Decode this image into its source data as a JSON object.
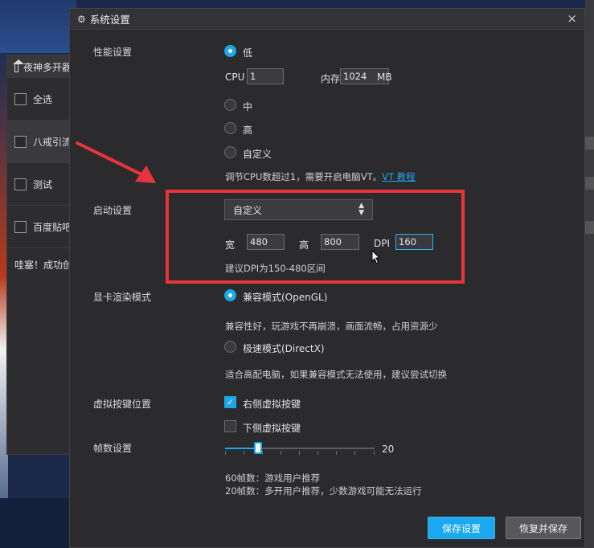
{
  "background_window": {
    "title": "夜神多开器",
    "select_all": "全选",
    "instances": [
      "八戒引流",
      "测试",
      "百度贴吧"
    ],
    "status_note": "哇塞！成功创"
  },
  "dialog": {
    "title": "系统设置",
    "performance": {
      "label": "性能设置",
      "options": [
        "低",
        "中",
        "高",
        "自定义"
      ],
      "selected": "低",
      "cpu_label": "CPU",
      "cpu_value": "1",
      "memory_label": "内存",
      "memory_value": "1024",
      "memory_unit": "MB",
      "hint_text": "调节CPU数超过1，需要开启电脑VT。",
      "hint_link": "VT 教程"
    },
    "startup": {
      "label": "启动设置",
      "resolution_selected": "自定义",
      "width_label": "宽",
      "width_value": "480",
      "height_label": "高",
      "height_value": "800",
      "dpi_label": "DPI",
      "dpi_value": "160",
      "hint": "建议DPI为150-480区间"
    },
    "render": {
      "label": "显卡渲染模式",
      "option1": "兼容模式(OpenGL)",
      "option1_desc": "兼容性好，玩游戏不再崩溃，画面流畅，占用资源少",
      "option2": "极速模式(DirectX)",
      "option2_desc": "适合高配电脑，如果兼容模式无法使用，建议尝试切换"
    },
    "virtual_keys": {
      "label": "虚拟按键位置",
      "option1": "右侧虚拟按键",
      "option1_checked": true,
      "option2": "下侧虚拟按键",
      "option2_checked": false
    },
    "fps": {
      "label": "帧数设置",
      "value": "20",
      "slider_fraction": 0.22,
      "hint1": "60帧数：游戏用户推荐",
      "hint2": "20帧数：多开用户推荐，少数游戏可能无法运行"
    },
    "buttons": {
      "save": "保存设置",
      "restore": "恢复并保存"
    }
  },
  "colors": {
    "accent": "#1aa7ec",
    "highlight": "#e8353c"
  }
}
